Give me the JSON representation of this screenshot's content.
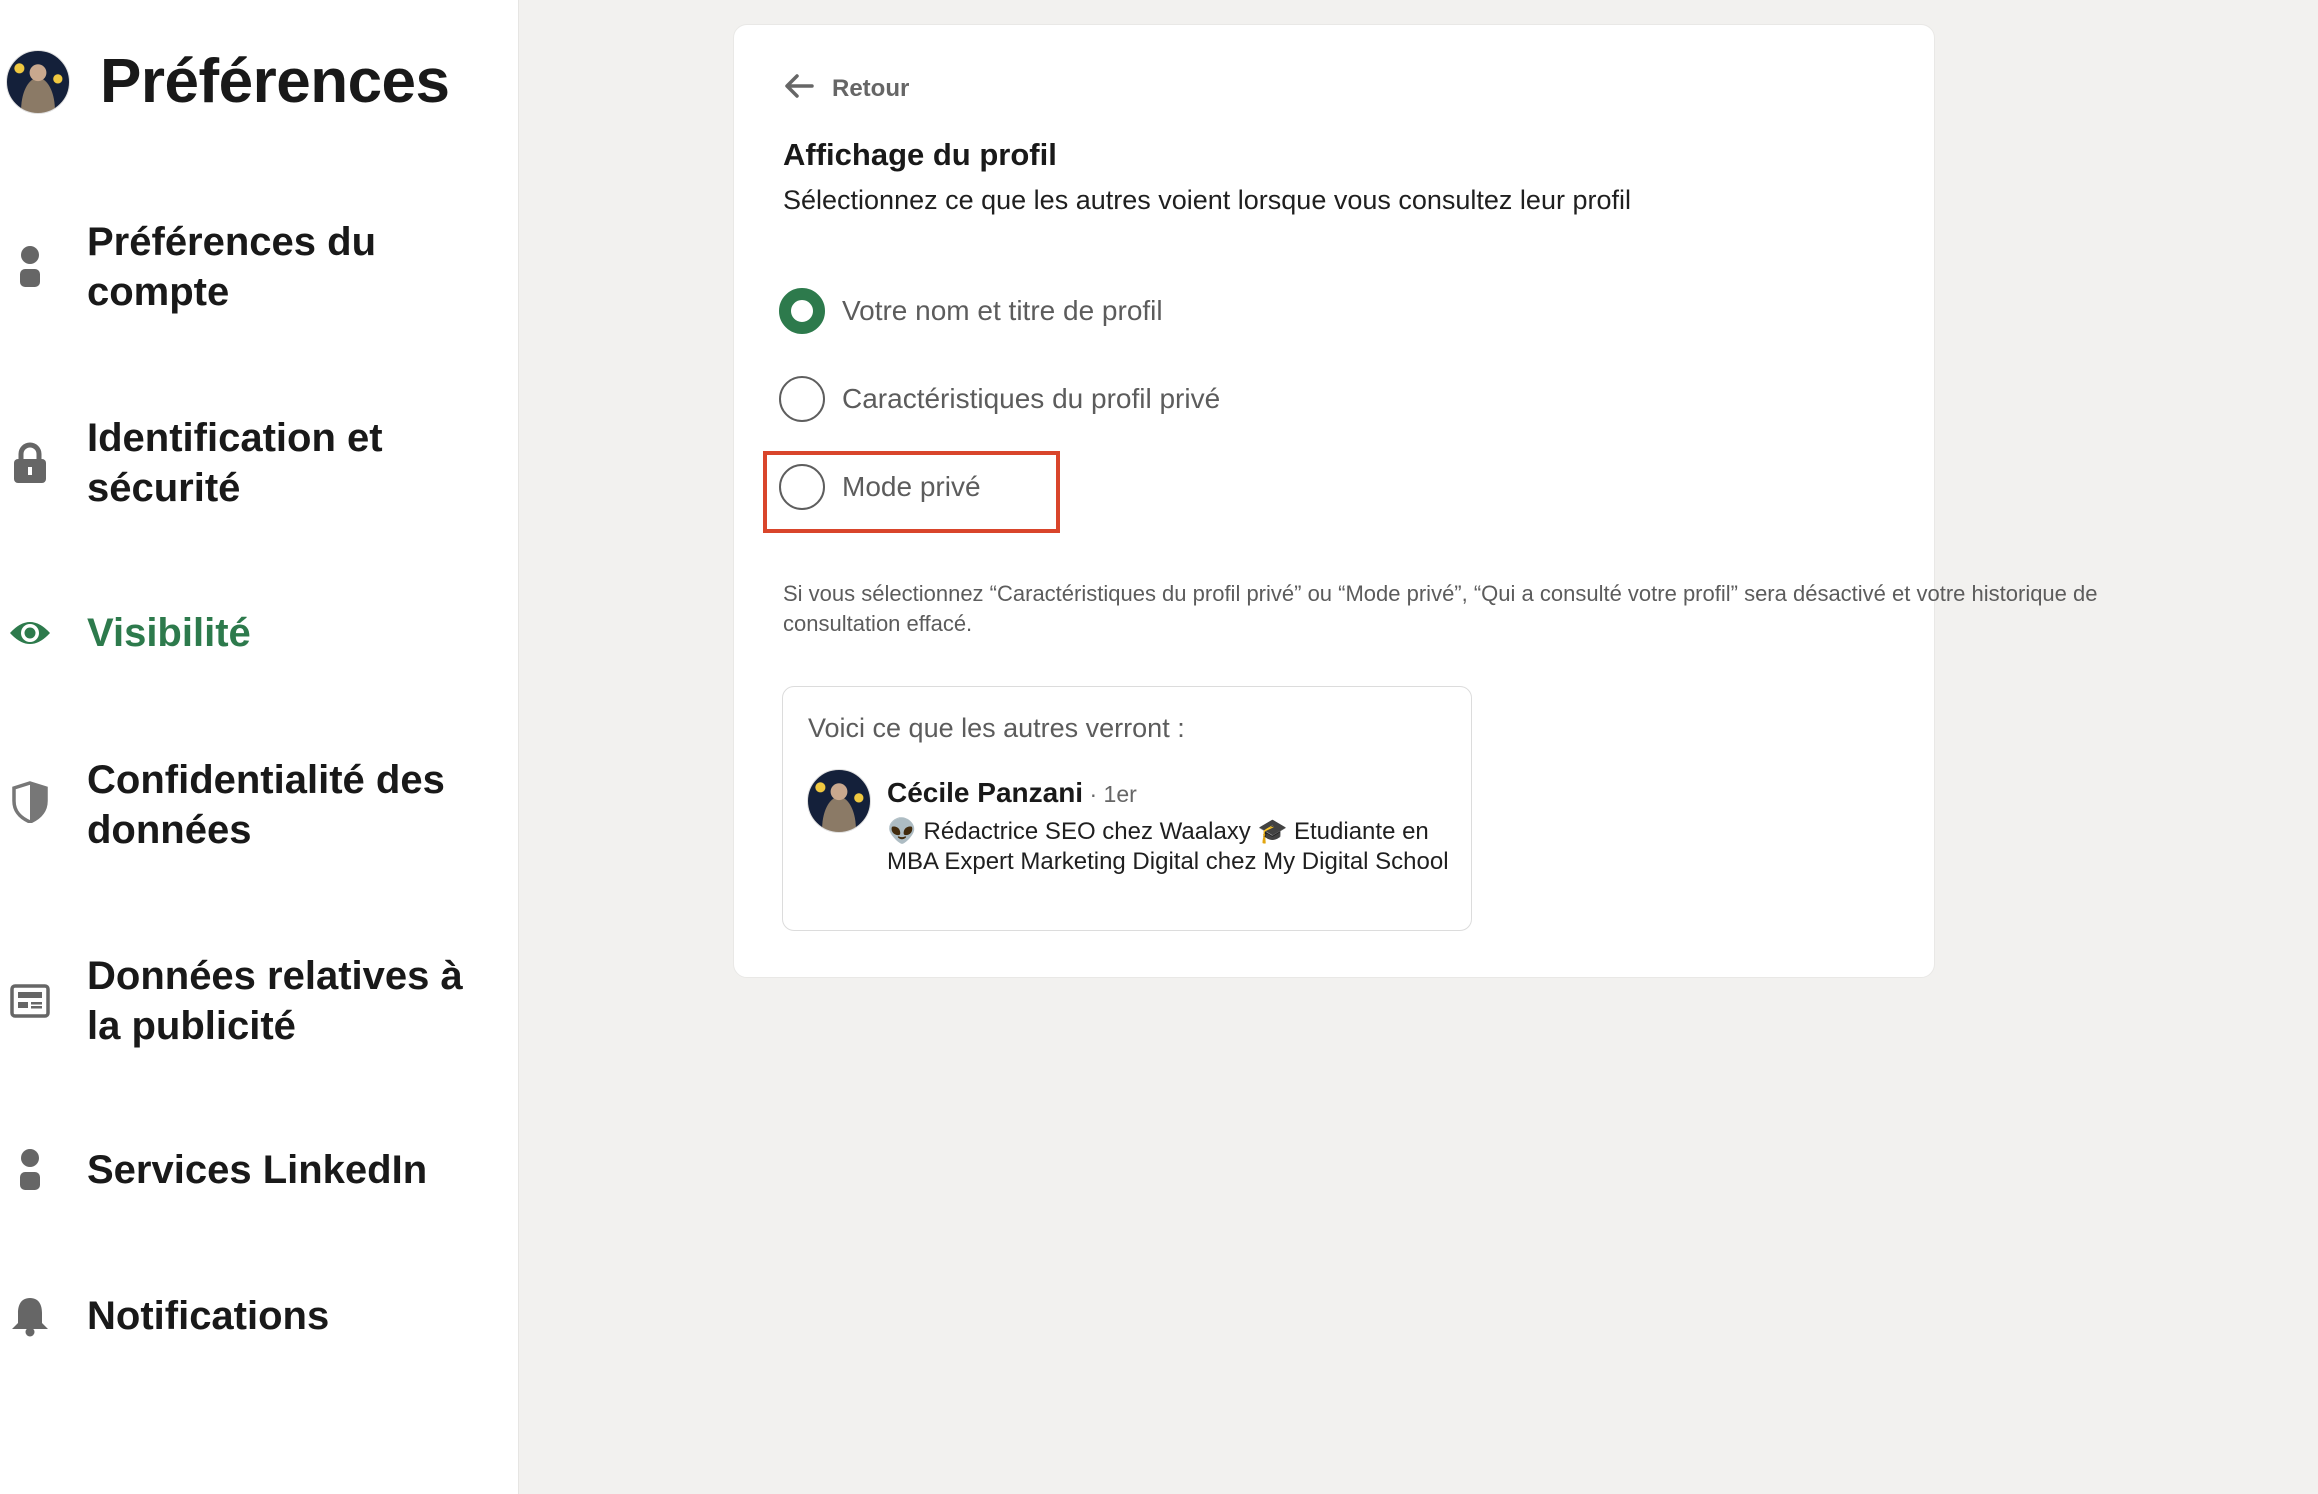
{
  "sidebar": {
    "title": "Préférences",
    "items": [
      {
        "label": "Préférences du compte",
        "icon": "person-icon",
        "active": false
      },
      {
        "label": "Identification et sécurité",
        "icon": "lock-icon",
        "active": false
      },
      {
        "label": "Visibilité",
        "icon": "eye-icon",
        "active": true
      },
      {
        "label": "Confidentialité des données",
        "icon": "shield-icon",
        "active": false
      },
      {
        "label": "Données relatives à la publicité",
        "icon": "newspaper-icon",
        "active": false
      },
      {
        "label": "Services LinkedIn",
        "icon": "person-icon",
        "active": false
      },
      {
        "label": "Notifications",
        "icon": "bell-icon",
        "active": false
      }
    ]
  },
  "main": {
    "back_label": "Retour",
    "heading": "Affichage du profil",
    "subtitle": "Sélectionnez ce que les autres voient lorsque vous consultez leur profil",
    "options": [
      {
        "label": "Votre nom et titre de profil",
        "checked": true
      },
      {
        "label": "Caractéristiques du profil privé",
        "checked": false
      },
      {
        "label": "Mode privé",
        "checked": false,
        "highlighted": true
      }
    ],
    "note": "Si vous sélectionnez “Caractéristiques du profil privé” ou “Mode privé”, “Qui a consulté votre profil” sera désactivé et votre historique de consultation effacé.",
    "preview": {
      "title": "Voici ce que les autres verront :",
      "name": "Cécile Panzani",
      "degree": " · 1er",
      "headline": "👽 Rédactrice SEO chez Waalaxy 🎓 Etudiante en MBA Expert Marketing Digital chez My Digital School"
    }
  },
  "colors": {
    "accent_green": "#2d7a4c",
    "highlight_red": "#d9452b",
    "page_bg": "#f2f1ef"
  }
}
